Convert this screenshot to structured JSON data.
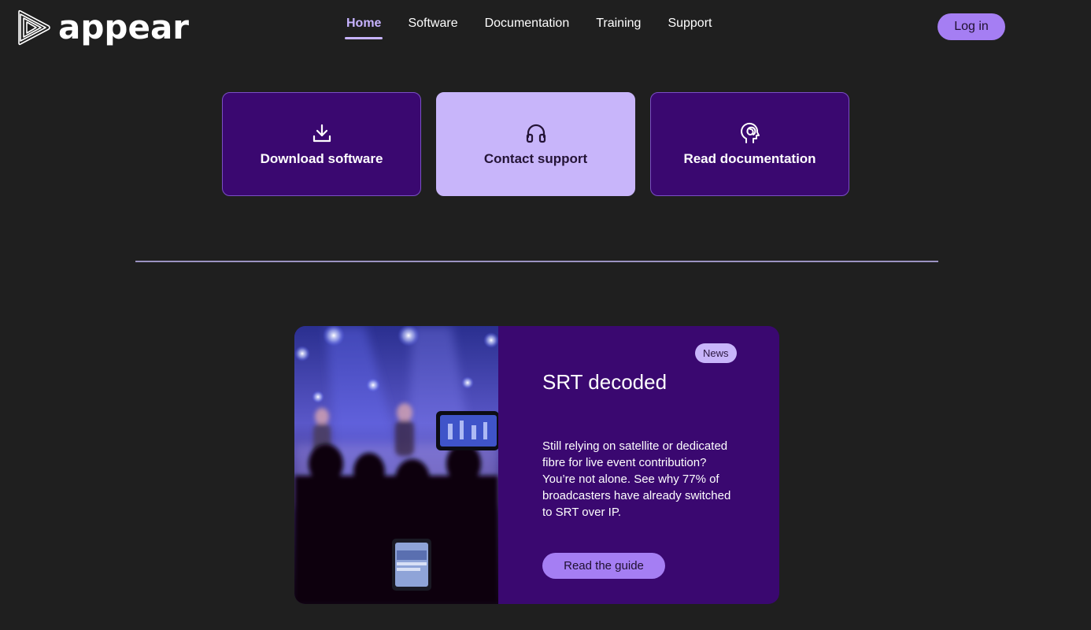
{
  "brand": {
    "name": "appear"
  },
  "nav": {
    "items": [
      {
        "label": "Home",
        "active": true
      },
      {
        "label": "Software",
        "active": false
      },
      {
        "label": "Documentation",
        "active": false
      },
      {
        "label": "Training",
        "active": false
      },
      {
        "label": "Support",
        "active": false
      }
    ],
    "login_label": "Log in"
  },
  "quick_actions": [
    {
      "label": "Download software",
      "icon": "download-icon",
      "style": "dark"
    },
    {
      "label": "Contact support",
      "icon": "headphones-icon",
      "style": "light"
    },
    {
      "label": "Read documentation",
      "icon": "head-idea-icon",
      "style": "dark"
    }
  ],
  "news": {
    "tag": "News",
    "title": "SRT decoded",
    "body": "Still relying on satellite or dedicated fibre for live event contribution? You’re not alone. See why 77% of broadcasters have already switched to SRT over IP.",
    "cta_label": "Read the guide",
    "image": "concert-crowd-phone-image"
  },
  "colors": {
    "background": "#1f1f1f",
    "accent": "#a57ef3",
    "card_dark": "#3a0870",
    "card_light": "#c8b5fa",
    "nav_active": "#c7b3ff"
  }
}
